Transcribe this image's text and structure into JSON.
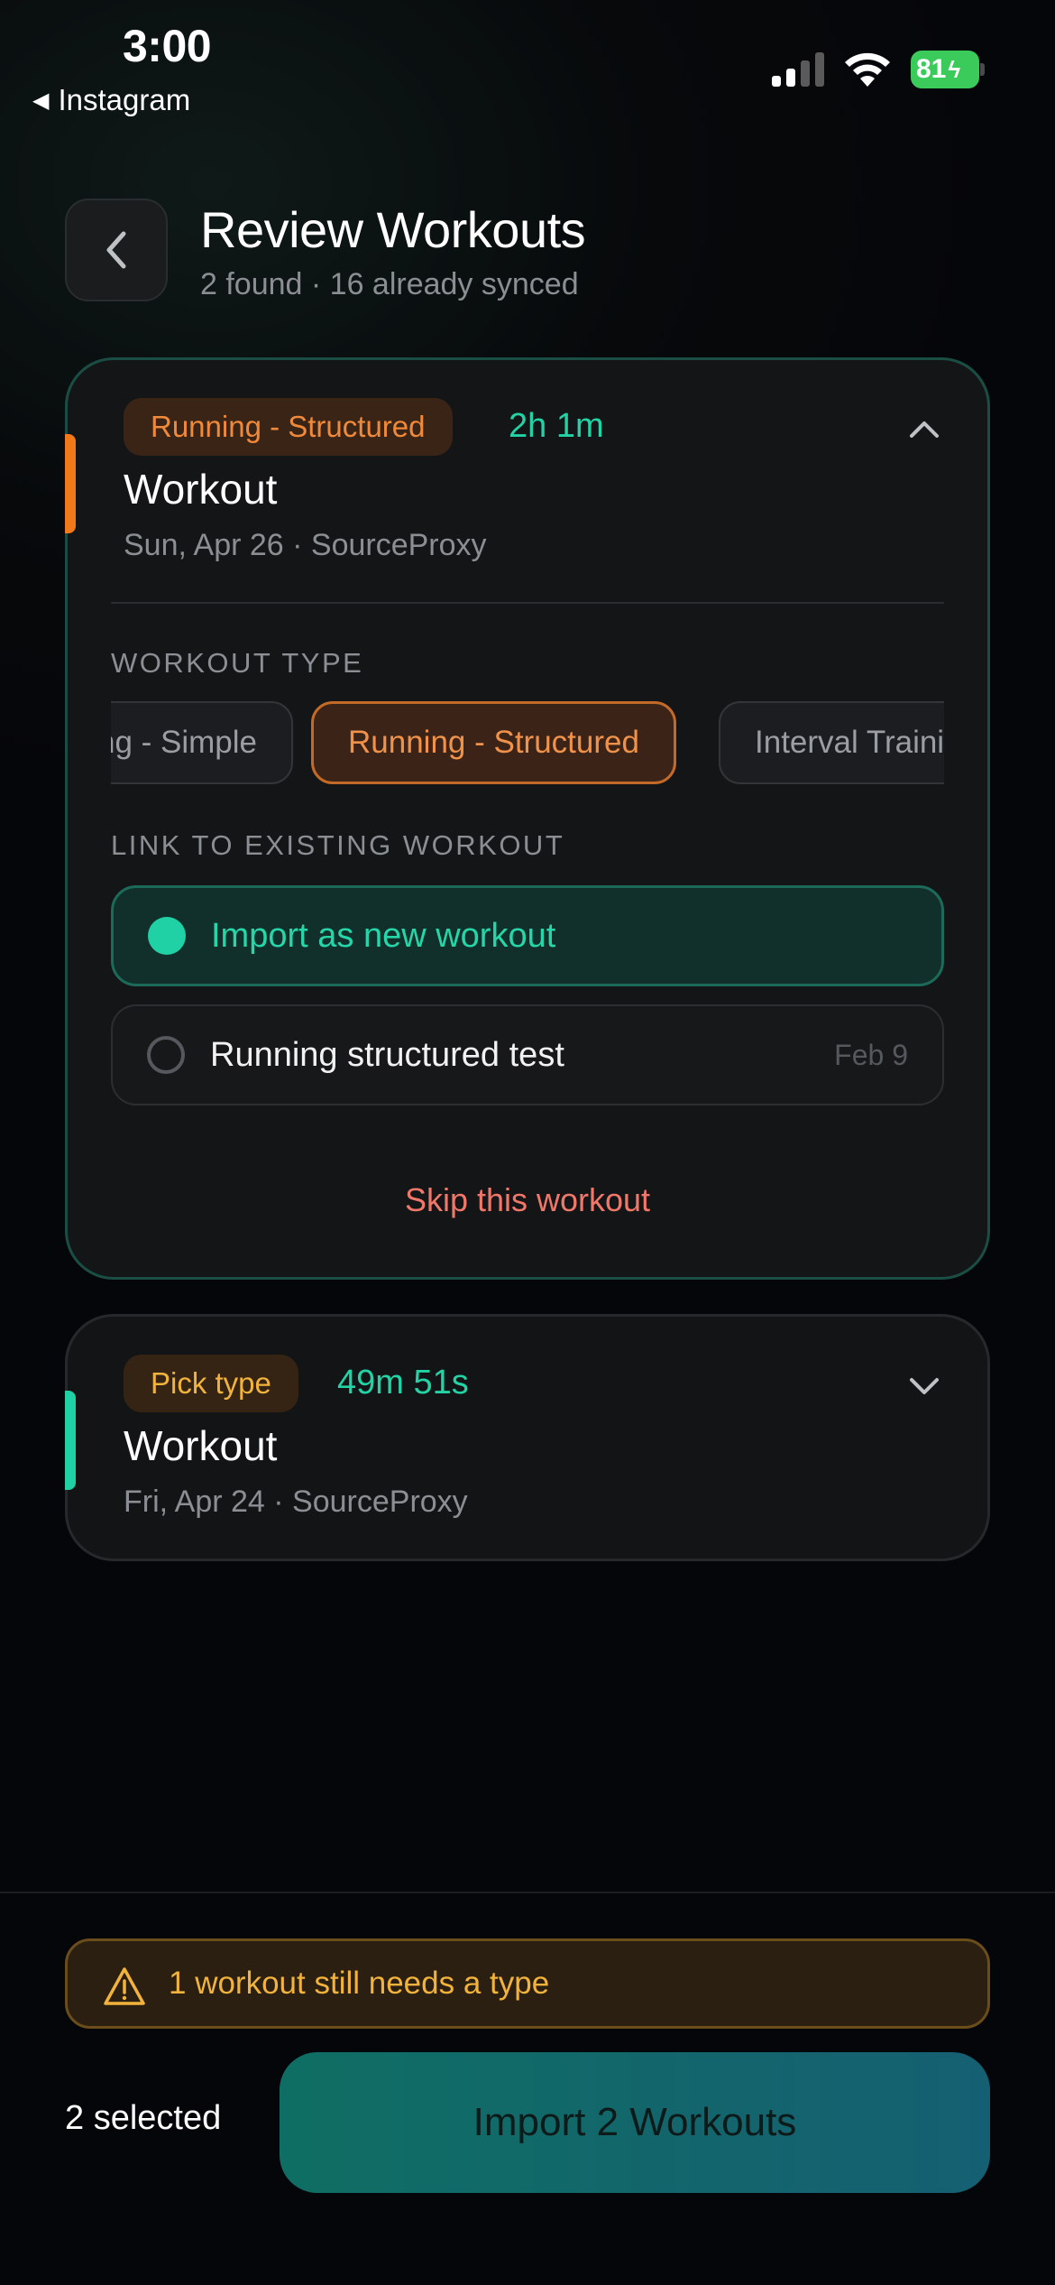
{
  "status_bar": {
    "time": "3:00",
    "back_app": "Instagram",
    "battery_level": "81",
    "icons": [
      "cellular-signal-icon",
      "wifi-icon",
      "battery-charging-icon"
    ]
  },
  "header": {
    "title": "Review Workouts",
    "subtitle": "2 found · 16 already synced",
    "back_icon": "chevron-left-icon"
  },
  "workouts": [
    {
      "badge": "Running - Structured",
      "duration": "2h 1m",
      "title": "Workout",
      "meta": "Sun, Apr 26 · SourceProxy",
      "expanded": true,
      "accent_color": "#f07a1a",
      "workout_type_label": "WORKOUT TYPE",
      "types": [
        "Running - Simple",
        "Running - Structured",
        "Interval Training"
      ],
      "selected_type": "Running - Structured",
      "link_label": "LINK TO EXISTING WORKOUT",
      "link_options": [
        {
          "label": "Import as new workout",
          "date": "",
          "selected": true
        },
        {
          "label": "Running structured test",
          "date": "Feb 9",
          "selected": false
        }
      ],
      "skip_label": "Skip this workout"
    },
    {
      "badge": "Pick type",
      "duration": "49m 51s",
      "title": "Workout",
      "meta": "Fri, Apr 24 · SourceProxy",
      "expanded": false,
      "accent_color": "#1fd1a4"
    }
  ],
  "footer": {
    "warning": "1 workout still needs a type",
    "selected_count": "2 selected",
    "import_button": "Import 2 Workouts"
  },
  "colors": {
    "accent_teal": "#22d3a6",
    "accent_orange": "#f08a3a",
    "warning_yellow": "#f2b33c",
    "skip_red": "#f0786a"
  }
}
